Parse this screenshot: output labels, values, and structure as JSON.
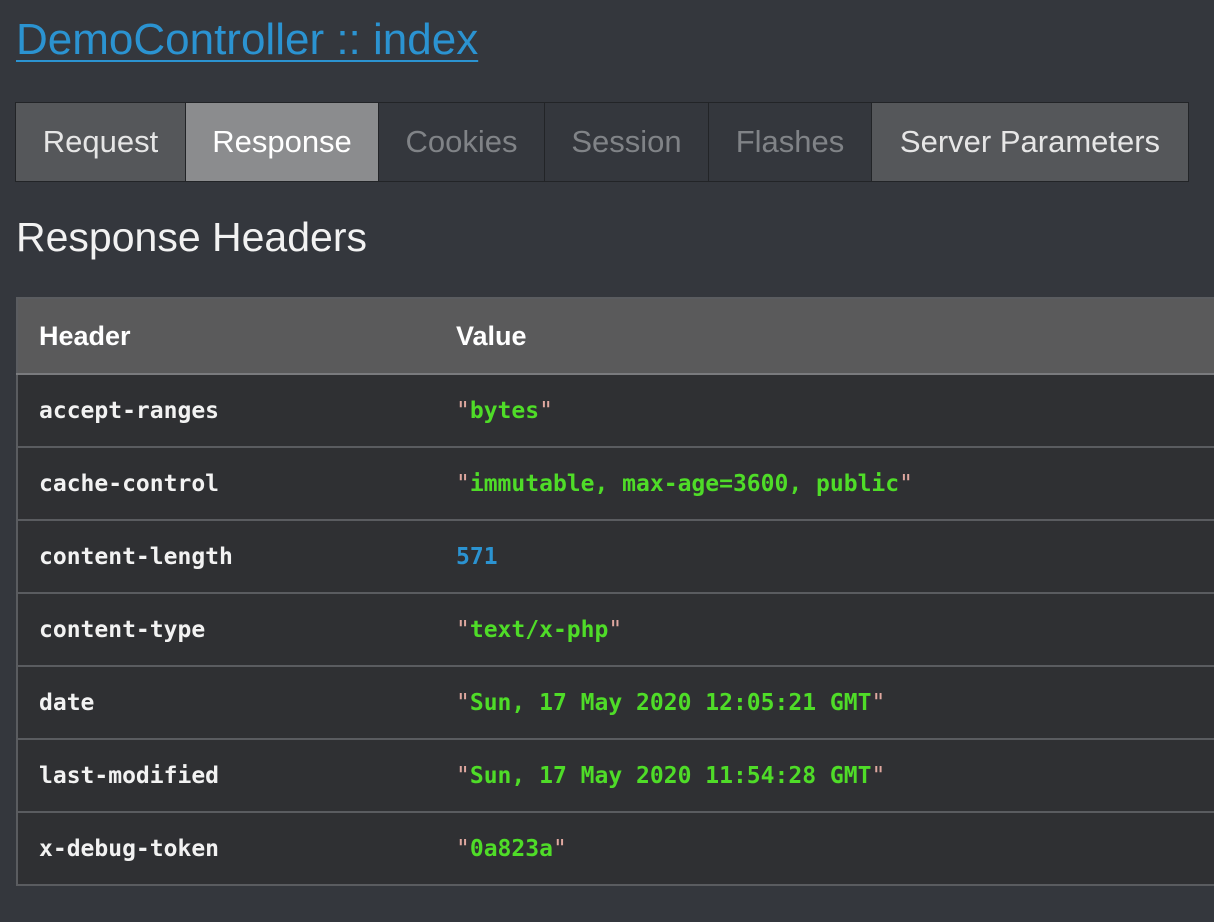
{
  "title": "DemoController :: index",
  "tabs": [
    {
      "label": "Request",
      "state": "default"
    },
    {
      "label": "Response",
      "state": "active"
    },
    {
      "label": "Cookies",
      "state": "disabled"
    },
    {
      "label": "Session",
      "state": "disabled"
    },
    {
      "label": "Flashes",
      "state": "disabled"
    },
    {
      "label": "Server Parameters",
      "state": "default"
    }
  ],
  "section_heading": "Response Headers",
  "table": {
    "columns": [
      "Header",
      "Value"
    ],
    "rows": [
      {
        "header": "accept-ranges",
        "value": "bytes",
        "type": "string"
      },
      {
        "header": "cache-control",
        "value": "immutable, max-age=3600, public",
        "type": "string"
      },
      {
        "header": "content-length",
        "value": "571",
        "type": "number"
      },
      {
        "header": "content-type",
        "value": "text/x-php",
        "type": "string"
      },
      {
        "header": "date",
        "value": "Sun, 17 May 2020 12:05:21 GMT",
        "type": "string"
      },
      {
        "header": "last-modified",
        "value": "Sun, 17 May 2020 11:54:28 GMT",
        "type": "string"
      },
      {
        "header": "x-debug-token",
        "value": "0a823a",
        "type": "string"
      }
    ]
  },
  "colors": {
    "background": "#34373d",
    "link": "#2b93d1",
    "string_value": "#4fdc28",
    "number_value": "#2b93d1"
  }
}
